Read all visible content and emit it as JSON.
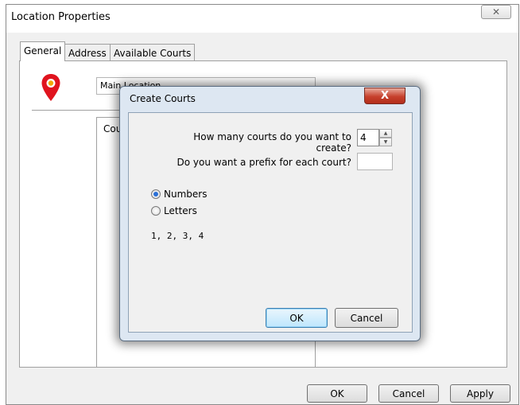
{
  "window": {
    "title": "Location Properties",
    "close_glyph": "✕"
  },
  "tabs": [
    {
      "label": "General",
      "active": true
    },
    {
      "label": "Address",
      "active": false
    },
    {
      "label": "Available Courts",
      "active": false
    }
  ],
  "general": {
    "name_value": "Main Location",
    "courts_group_label": "Courts",
    "pin_icon": "map-pin-icon",
    "pin_color": "#e0141e"
  },
  "footer": {
    "ok_label": "OK",
    "cancel_label": "Cancel",
    "apply_label": "Apply"
  },
  "dialog": {
    "title": "Create Courts",
    "close_glyph": "X",
    "count_question": "How many courts do you want to create?",
    "count_value": "4",
    "prefix_question": "Do you want a prefix for each court?",
    "prefix_value": "",
    "options": [
      {
        "label": "Numbers",
        "checked": true
      },
      {
        "label": "Letters",
        "checked": false
      }
    ],
    "preview": "1, 2, 3, 4",
    "ok_label": "OK",
    "cancel_label": "Cancel"
  }
}
